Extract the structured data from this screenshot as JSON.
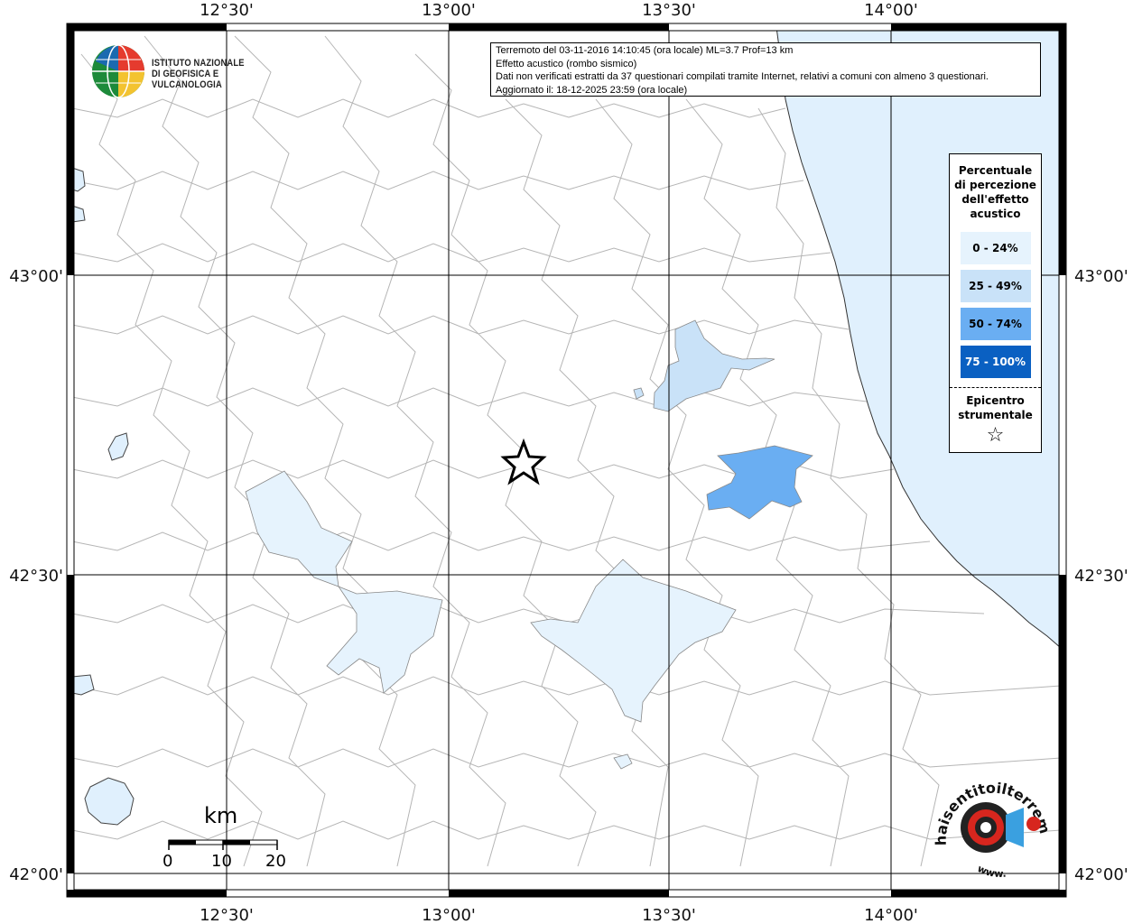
{
  "header": {
    "line1": "Terremoto del 03-11-2016 14:10:45 (ora locale) ML=3.7 Prof=13 km",
    "line2": "Effetto acustico (rombo sismico)",
    "line3": "Dati non verificati estratti da 37 questionari compilati tramite Internet, relativi a comuni con almeno 3 questionari.",
    "line4": "Aggiornato il: 18-12-2025 23:59 (ora locale)"
  },
  "ingv": {
    "line1": "ISTITUTO NAZIONALE",
    "line2": "DI GEOFISICA E VULCANOLOGIA"
  },
  "axes": {
    "top": [
      "12°30'",
      "13°00'",
      "13°30'",
      "14°00'"
    ],
    "bottom": [
      "12°30'",
      "13°00'",
      "13°30'",
      "14°00'"
    ],
    "left": [
      "43°00'",
      "42°30'",
      "42°00'"
    ],
    "right": [
      "43°00'",
      "42°30'",
      "42°00'"
    ]
  },
  "legend": {
    "title_lines": [
      "Percentuale",
      "di percezione",
      "dell'effetto",
      "acustico"
    ],
    "items": [
      {
        "label": "0 - 24%",
        "color": "#e6f3fd"
      },
      {
        "label": "25 - 49%",
        "color": "#c9e2f8"
      },
      {
        "label": "50 - 74%",
        "color": "#6aaef2"
      },
      {
        "label": "75 - 100%",
        "color": "#0a60c2"
      }
    ],
    "epicenter_lines": [
      "Epicentro",
      "strumentale"
    ],
    "epicenter_symbol": "☆"
  },
  "scale": {
    "unit": "km",
    "ticks": [
      "0",
      "10",
      "20"
    ]
  },
  "site_logo": {
    "text": "haisentitoilterremoto.it",
    "url_text": "www."
  },
  "colors": {
    "sea": "#e0f0fd",
    "border": "#bbbbbb",
    "grid": "#000000"
  }
}
